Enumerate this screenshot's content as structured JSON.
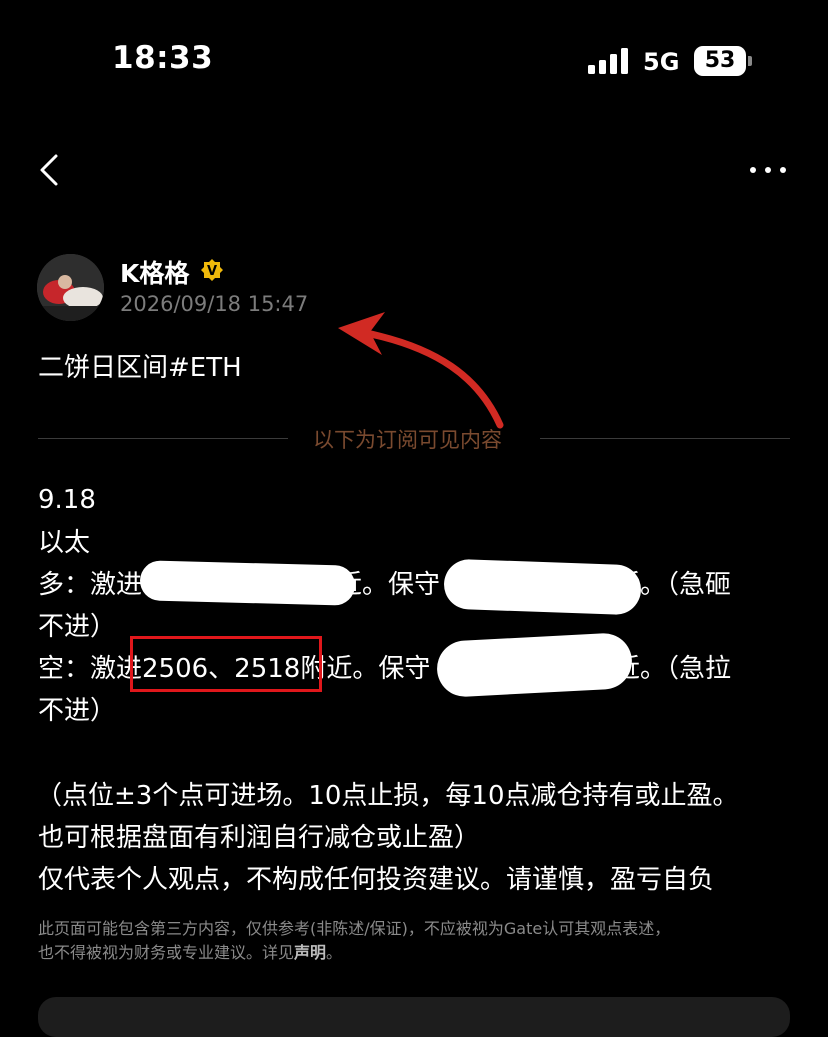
{
  "status_bar": {
    "time": "18:33",
    "network": "5G",
    "battery": "53"
  },
  "post": {
    "author": "K格格",
    "date": "2026/09/18 15:47",
    "title": "二饼日区间#ETH",
    "subscriber_note": "以下为订阅可见内容",
    "lines": [
      "9.18",
      "以太",
      "多：激进",
      "近。保守",
      "附近。（急砸",
      "不进）",
      "空：激进2506、2518附近。保守",
      "附近。（急拉",
      "不进）",
      "（点位±3个点可进场。10点止损，每10点减仓持有或止盈。",
      "也可根据盘面有利润自行减仓或止盈）",
      "仅代表个人观点，不构成任何投资建议。请谨慎，盈亏自负"
    ]
  },
  "disclaimer": {
    "text_1": "此页面可能包含第三方内容，仅供参考(非陈述/保证)，不应被视为Gate认可其观点表述，",
    "text_2": "也不得被视为财务或专业建议。详见",
    "link": "声明",
    "end": "。"
  },
  "colors": {
    "accent_red": "#e0171b",
    "verified_gold": "#f0b90b",
    "note_brown": "#7a4a2f"
  }
}
